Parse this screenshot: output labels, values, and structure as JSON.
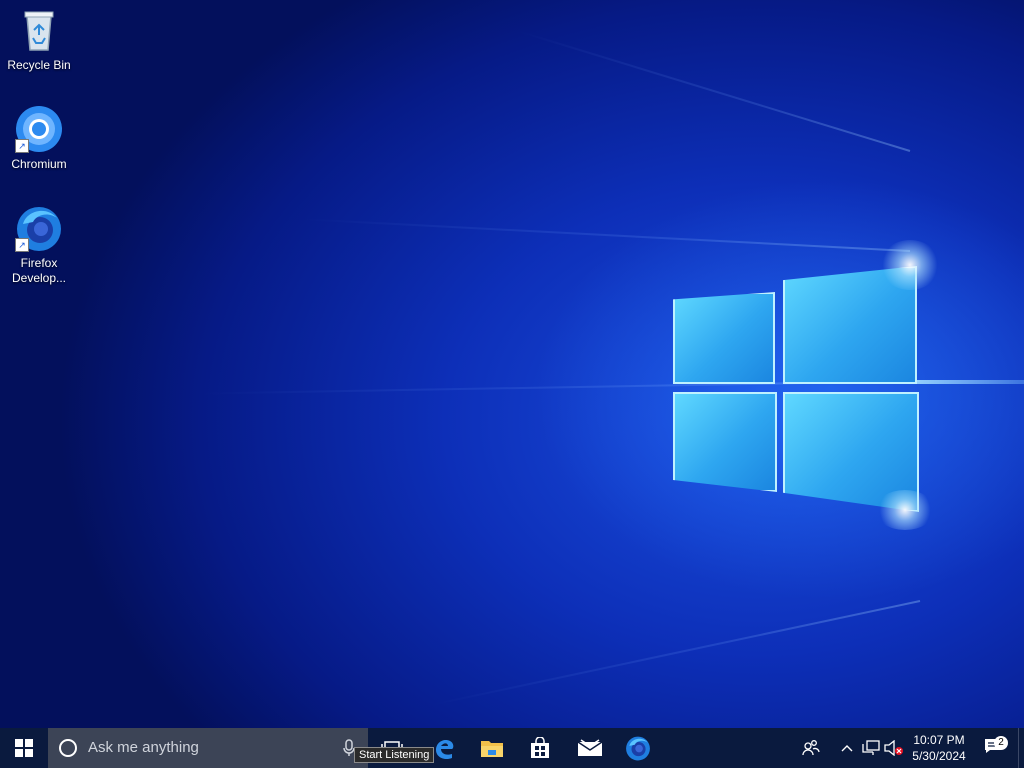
{
  "desktop": {
    "icons": [
      {
        "label": "Recycle Bin",
        "icon": "recycle-bin-icon"
      },
      {
        "label": "Chromium",
        "icon": "chromium-icon"
      },
      {
        "label": "Firefox Develop...",
        "icon": "firefox-developer-icon"
      }
    ]
  },
  "taskbar": {
    "start_icon": "windows-start-icon",
    "search_placeholder": "Ask me anything",
    "mic_tooltip": "Start Listening",
    "pinned": [
      {
        "name": "task-view",
        "icon": "task-view-icon"
      },
      {
        "name": "edge",
        "icon": "edge-icon"
      },
      {
        "name": "file-explorer",
        "icon": "folder-icon"
      },
      {
        "name": "store",
        "icon": "store-icon"
      },
      {
        "name": "mail",
        "icon": "mail-icon"
      },
      {
        "name": "firefox-developer",
        "icon": "firefox-developer-icon"
      }
    ],
    "tray": {
      "time": "10:07 PM",
      "date": "5/30/2024",
      "notification_count": "2"
    }
  },
  "colors": {
    "taskbar_bg": "#0a1a3e",
    "search_bg": "#3c4456",
    "wallpaper_blue": "#0d2fb8",
    "logo_cyan": "#5fd8ff"
  }
}
